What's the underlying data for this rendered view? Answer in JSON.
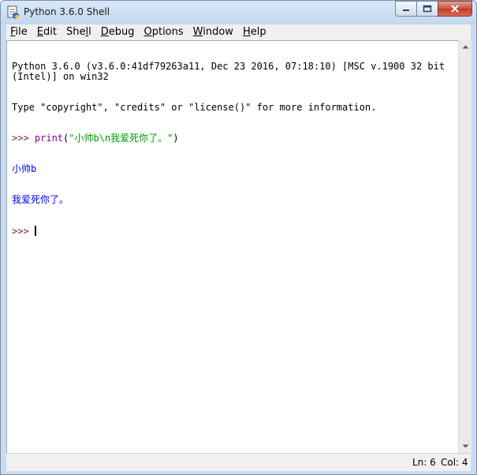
{
  "window": {
    "title": "Python 3.6.0 Shell",
    "caption_buttons": [
      "minimize-icon",
      "maximize-icon",
      "close-icon"
    ]
  },
  "menu": {
    "items": [
      {
        "label": "File",
        "mnemonic": "F",
        "rest": "ile"
      },
      {
        "label": "Edit",
        "mnemonic": "E",
        "rest": "dit"
      },
      {
        "label": "Shell",
        "pre": "She",
        "mnemonic": "l",
        "rest": "l"
      },
      {
        "label": "Debug",
        "mnemonic": "D",
        "rest": "ebug"
      },
      {
        "label": "Options",
        "mnemonic": "O",
        "rest": "ptions"
      },
      {
        "label": "Window",
        "mnemonic": "W",
        "rest": "indow"
      },
      {
        "label": "Help",
        "mnemonic": "H",
        "rest": "elp"
      }
    ]
  },
  "shell": {
    "banner_line1": "Python 3.6.0 (v3.6.0:41df79263a11, Dec 23 2016, 07:18:10) [MSC v.1900 32 bit (Intel)] on win32",
    "banner_line2": "Type \"copyright\", \"credits\" or \"license()\" for more information.",
    "prompt": ">>> ",
    "command_keyword": "print",
    "command_paren_open": "(",
    "command_string": "\"小帅b\\n我爱死你了。\"",
    "command_paren_close": ")",
    "output_line1": "小帅b",
    "output_line2": "我爱死你了。",
    "final_prompt": ">>> "
  },
  "status": {
    "ln": "Ln: 6",
    "col": "Col: 4"
  },
  "colors": {
    "prompt": "#7a2424",
    "keyword": "#8a008a",
    "string": "#009900",
    "stdout": "#0000ff"
  }
}
